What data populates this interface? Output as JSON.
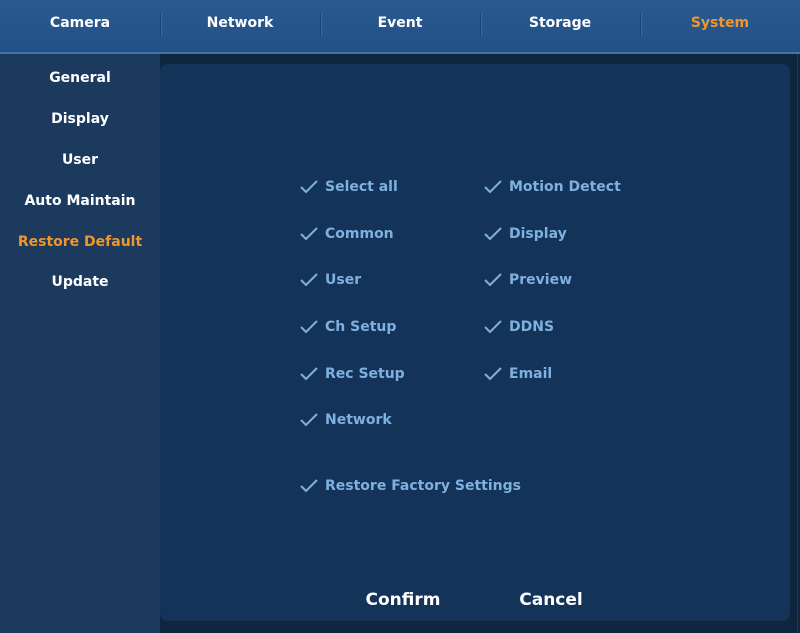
{
  "topnav": {
    "tabs": [
      {
        "label": "Camera",
        "active": false
      },
      {
        "label": "Network",
        "active": false
      },
      {
        "label": "Event",
        "active": false
      },
      {
        "label": "Storage",
        "active": false
      },
      {
        "label": "System",
        "active": true
      }
    ]
  },
  "sidebar": {
    "items": [
      {
        "label": "General",
        "active": false
      },
      {
        "label": "Display",
        "active": false
      },
      {
        "label": "User",
        "active": false
      },
      {
        "label": "Auto Maintain",
        "active": false
      },
      {
        "label": "Restore Default",
        "active": true
      },
      {
        "label": "Update",
        "active": false
      }
    ]
  },
  "restore": {
    "options_left": [
      {
        "label": "Select all",
        "checked": true
      },
      {
        "label": "Common",
        "checked": true
      },
      {
        "label": "User",
        "checked": true
      },
      {
        "label": "Ch Setup",
        "checked": true
      },
      {
        "label": "Rec Setup",
        "checked": true
      },
      {
        "label": "Network",
        "checked": true
      }
    ],
    "options_right": [
      {
        "label": "Motion Detect",
        "checked": true
      },
      {
        "label": "Display",
        "checked": true
      },
      {
        "label": "Preview",
        "checked": true
      },
      {
        "label": "DDNS",
        "checked": true
      },
      {
        "label": "Email",
        "checked": true
      }
    ],
    "factory": {
      "label": "Restore Factory Settings",
      "checked": true
    },
    "confirm_label": "Confirm",
    "cancel_label": "Cancel"
  },
  "colors": {
    "accent": "#f0962a",
    "option_text": "#7fb0de",
    "nav_bar": "#225087",
    "sidebar_bg": "#1b3a5d",
    "panel_bg": "#143358"
  },
  "icons": {
    "checkmark": "check-icon"
  }
}
